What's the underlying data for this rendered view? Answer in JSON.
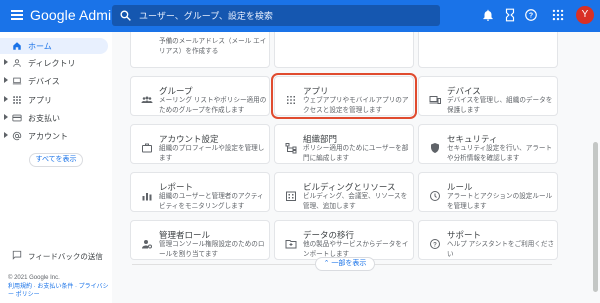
{
  "header": {
    "app_title": "Google Admin",
    "search_placeholder": "ユーザー、グループ、設定を検索",
    "avatar_letter": "Y"
  },
  "sidebar": {
    "items": [
      {
        "label": "ホーム",
        "active": true
      },
      {
        "label": "ディレクトリ"
      },
      {
        "label": "デバイス"
      },
      {
        "label": "アプリ"
      },
      {
        "label": "お支払い"
      },
      {
        "label": "アカウント"
      }
    ],
    "show_all": "すべてを表示",
    "feedback": "フィードバックの送信",
    "copyright": "© 2021 Google Inc.",
    "footer_links": "利用規約 · お支払い条件 · プライバシー ポリシー"
  },
  "main": {
    "top_card_desc": "予備のメールアドレス（メール エイリアス）を作成する",
    "cards": [
      {
        "title": "グループ",
        "desc": "メーリング リストやポリシー適用のためのグループを作成します",
        "icon": "groups-icon"
      },
      {
        "title": "アプリ",
        "desc": "ウェブアプリやモバイルアプリのアクセスと設定を管理します",
        "icon": "apps-grid-icon"
      },
      {
        "title": "デバイス",
        "desc": "デバイスを管理し、組織のデータを保護します",
        "icon": "devices-icon"
      },
      {
        "title": "アカウント設定",
        "desc": "組織のプロフィールや設定を管理します",
        "icon": "briefcase-icon"
      },
      {
        "title": "組織部門",
        "desc": "ポリシー適用のためにユーザーを部門に編成します",
        "icon": "org-chart-icon"
      },
      {
        "title": "セキュリティ",
        "desc": "セキュリティ設定を行い、アラートや分析情報を確認します",
        "icon": "shield-icon"
      },
      {
        "title": "レポート",
        "desc": "組織のユーザーと管理者のアクティビティをモニタリングします",
        "icon": "bar-chart-icon"
      },
      {
        "title": "ビルディングとリソース",
        "desc": "ビルディング、会議室、リソースを管理、追加します",
        "icon": "building-icon"
      },
      {
        "title": "ルール",
        "desc": "アラートとアクションの設定ルールを管理します",
        "icon": "rule-icon"
      },
      {
        "title": "管理者ロール",
        "desc": "管理コンソール権限設定のためのロールを割り当てます",
        "icon": "admin-role-icon"
      },
      {
        "title": "データの移行",
        "desc": "他の製品やサービスからデータをインポートします",
        "icon": "data-migration-icon"
      },
      {
        "title": "サポート",
        "desc": "ヘルプ アシスタントをご利用ください",
        "icon": "support-icon"
      }
    ],
    "show_less": "一部を表示"
  },
  "colors": {
    "topbar": "#1a73e8",
    "search_bg": "#1557b0",
    "highlight_border": "#e04b2f",
    "avatar": "#d93025",
    "link": "#1a73e8"
  }
}
